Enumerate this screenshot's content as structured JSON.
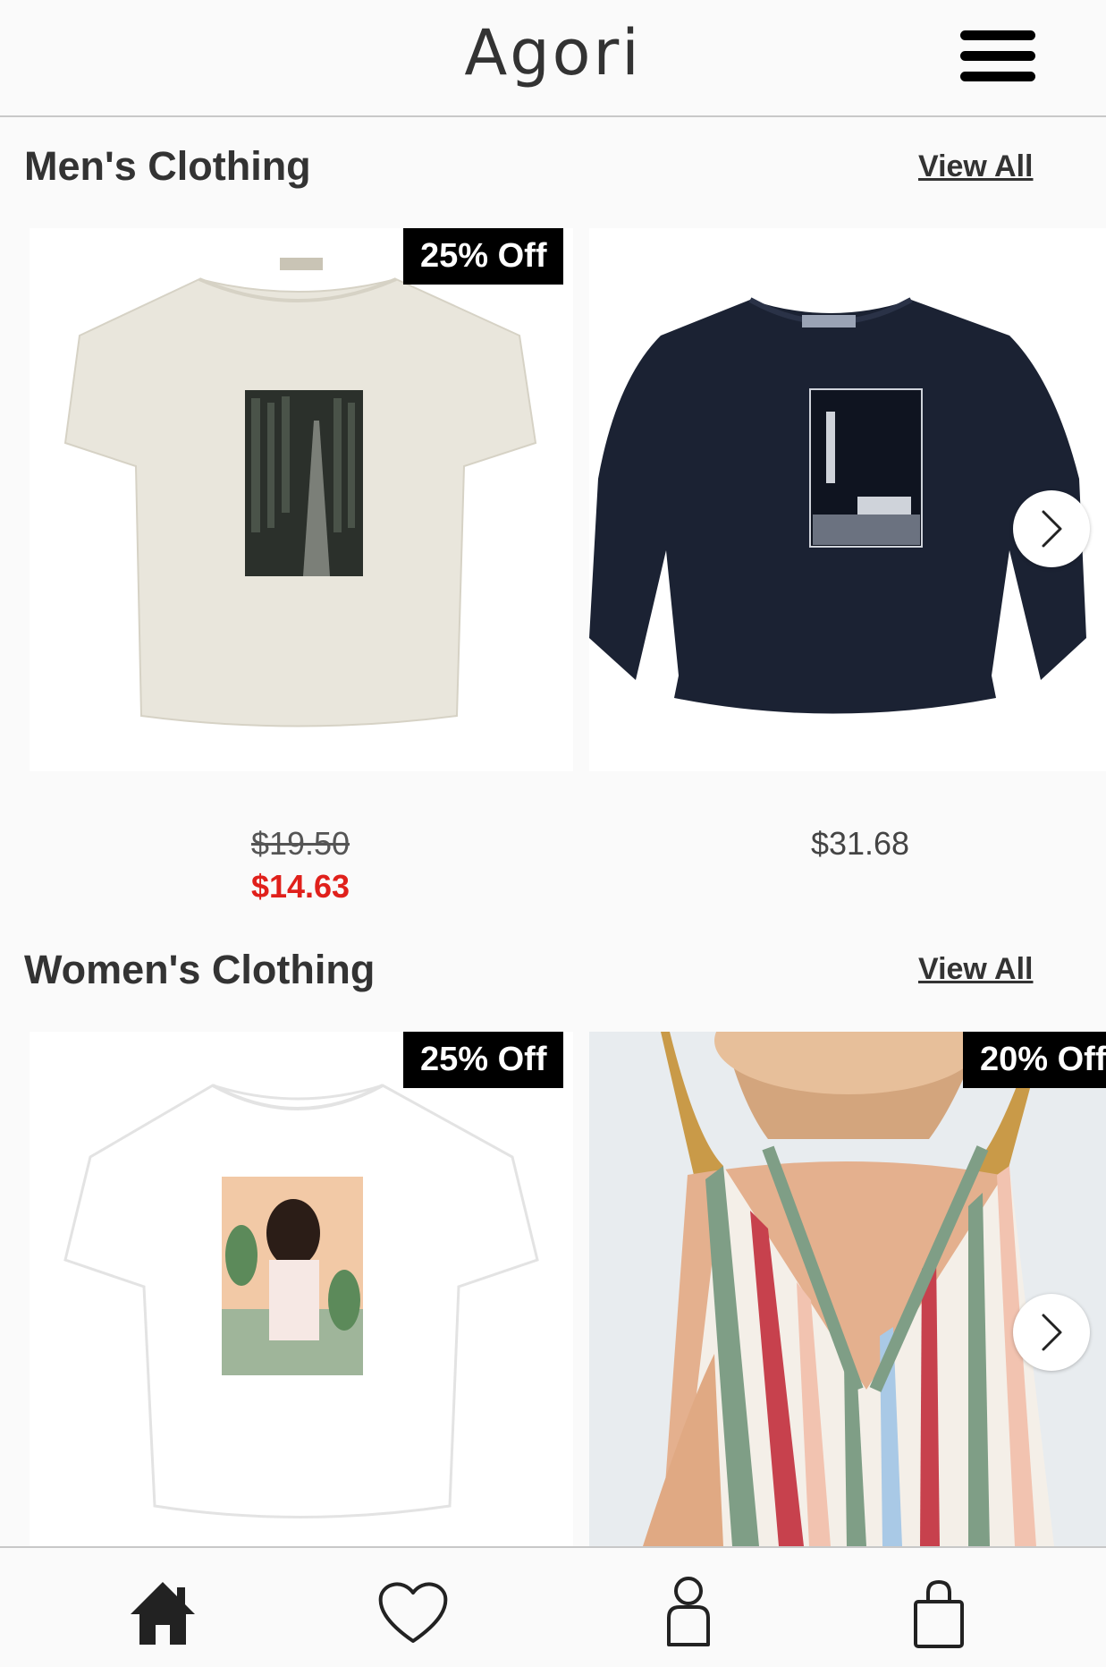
{
  "app": {
    "title": "Agori"
  },
  "sections": [
    {
      "title": "Men's Clothing",
      "view_all": "View All",
      "products": [
        {
          "badge": "25% Off",
          "price_original": "$19.50",
          "price_sale": "$14.63",
          "image": "cream t-shirt with forest road print"
        },
        {
          "price": "$31.68",
          "image": "navy sweatshirt with desert night print"
        }
      ]
    },
    {
      "title": "Women's Clothing",
      "view_all": "View All",
      "products": [
        {
          "badge": "25% Off",
          "image": "white t-shirt with illustrated woman print"
        },
        {
          "badge": "20% Off",
          "image": "striped v-neck cami top"
        }
      ]
    }
  ],
  "nav": {
    "icons": [
      "home-icon",
      "heart-icon",
      "user-icon",
      "shopping-bag-icon"
    ]
  },
  "colors": {
    "sale": "#e0201b",
    "badge_bg": "#000000",
    "text": "#333333"
  }
}
